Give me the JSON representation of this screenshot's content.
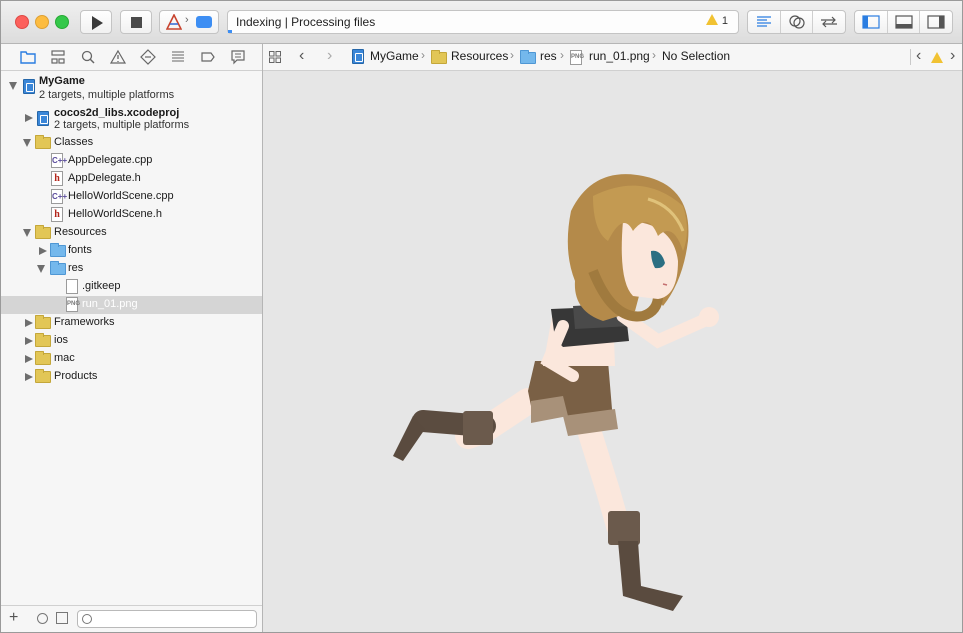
{
  "toolbar": {
    "run_icon": "play-icon",
    "stop_icon": "stop-icon",
    "scheme_icon": "app-icon",
    "device_icon": "device-icon",
    "activity_text": "Indexing  |  Processing files",
    "warning_count": "1"
  },
  "nav_tabs": [
    "folder-icon",
    "hierarchy-icon",
    "search-icon",
    "warning-icon",
    "test-diamond-icon",
    "debug-list-icon",
    "breakpoint-icon",
    "log-bubble-icon"
  ],
  "tree": {
    "project": {
      "name": "MyGame",
      "subtitle": "2 targets, multiple platforms"
    },
    "libs": {
      "name": "cocos2d_libs.xcodeproj",
      "subtitle": "2 targets, multiple platforms"
    },
    "classes": "Classes",
    "files_classes": [
      "AppDelegate.cpp",
      "AppDelegate.h",
      "HelloWorldScene.cpp",
      "HelloWorldScene.h"
    ],
    "file_badges": {
      "cpp": "C++",
      "h": "h",
      "png": "PNG"
    },
    "resources": "Resources",
    "fonts": "fonts",
    "res": "res",
    "gitkeep": ".gitkeep",
    "selected_file": "run_01.png",
    "frameworks": "Frameworks",
    "ios": "ios",
    "mac": "mac",
    "products": "Products"
  },
  "footer": {
    "add_label": "+"
  },
  "jumpbar": {
    "items": [
      "MyGame",
      "Resources",
      "res",
      "run_01.png",
      "No Selection"
    ],
    "back": "‹",
    "forward": "›"
  },
  "colors": {
    "accent": "#3d8ef3",
    "folder": "#e2c656",
    "folder_blue": "#74b8ec",
    "selection": "#d5d5d5"
  }
}
